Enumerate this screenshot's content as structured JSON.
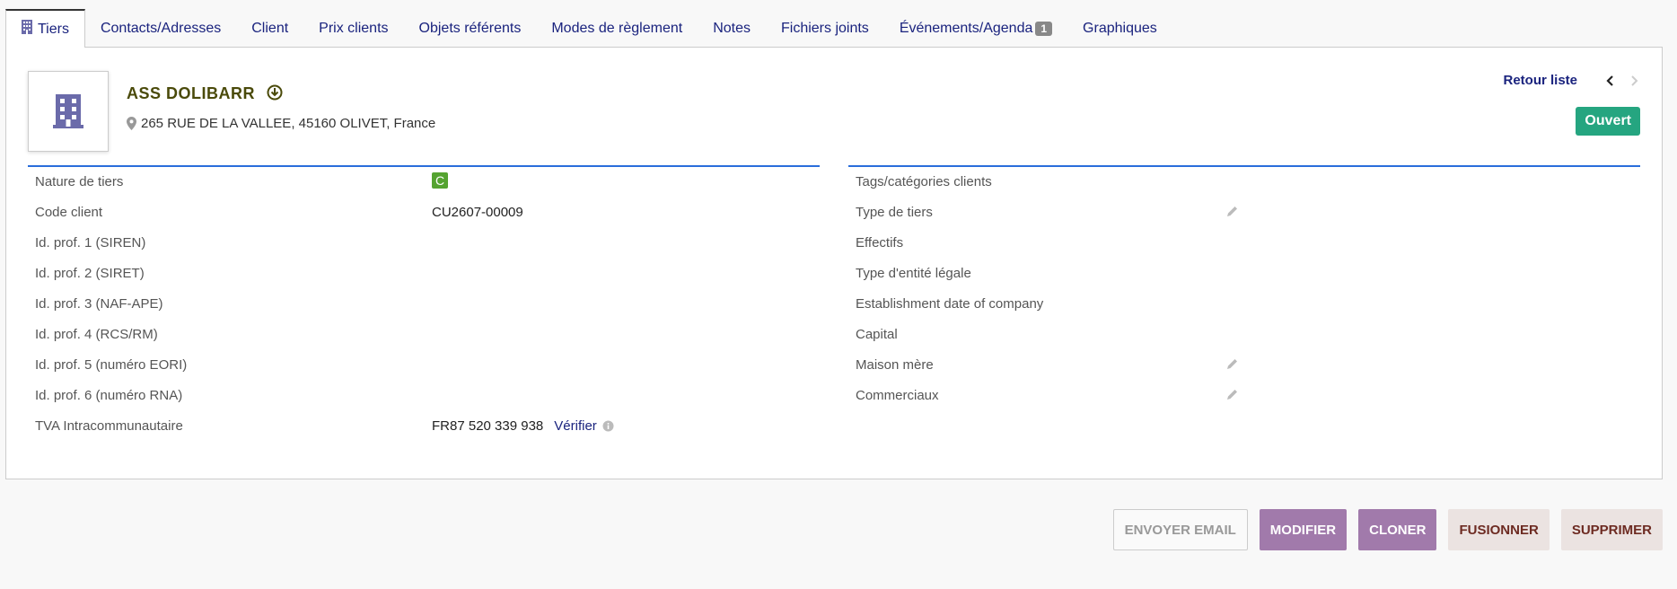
{
  "tabs": [
    {
      "label": "Tiers",
      "active": true
    },
    {
      "label": "Contacts/Adresses"
    },
    {
      "label": "Client"
    },
    {
      "label": "Prix clients"
    },
    {
      "label": "Objets référents"
    },
    {
      "label": "Modes de règlement"
    },
    {
      "label": "Notes"
    },
    {
      "label": "Fichiers joints"
    },
    {
      "label": "Événements/Agenda",
      "badge": "1"
    },
    {
      "label": "Graphiques"
    }
  ],
  "header": {
    "name": "ASS DOLIBARR",
    "address": "265 RUE DE LA VALLEE, 45160 OLIVET, France",
    "back_label": "Retour liste",
    "status": "Ouvert",
    "status_color": "#25a580"
  },
  "left_fields": [
    {
      "label": "Nature de tiers",
      "value": "C"
    },
    {
      "label": "Code client",
      "value": "CU2607-00009"
    },
    {
      "label": "Id. prof. 1 (SIREN)",
      "value": ""
    },
    {
      "label": "Id. prof. 2 (SIRET)",
      "value": ""
    },
    {
      "label": "Id. prof. 3 (NAF-APE)",
      "value": ""
    },
    {
      "label": "Id. prof. 4 (RCS/RM)",
      "value": ""
    },
    {
      "label": "Id. prof. 5 (numéro EORI)",
      "value": ""
    },
    {
      "label": "Id. prof. 6 (numéro RNA)",
      "value": ""
    },
    {
      "label": "TVA Intracommunautaire",
      "value": "FR87 520 339 938",
      "link": "Vérifier"
    }
  ],
  "right_fields": [
    {
      "label": "Tags/catégories clients"
    },
    {
      "label": "Type de tiers",
      "editable": true
    },
    {
      "label": "Effectifs"
    },
    {
      "label": "Type d'entité légale"
    },
    {
      "label": "Establishment date of company"
    },
    {
      "label": "Capital"
    },
    {
      "label": "Maison mère",
      "editable": true
    },
    {
      "label": "Commerciaux",
      "editable": true
    }
  ],
  "actions": {
    "email": "ENVOYER EMAIL",
    "modify": "MODIFIER",
    "clone": "CLONER",
    "merge": "FUSIONNER",
    "delete": "SUPPRIMER"
  },
  "colors": {
    "accent": "#2a6edb",
    "nav": "#1a237e",
    "primary_button": "#a17aab"
  }
}
